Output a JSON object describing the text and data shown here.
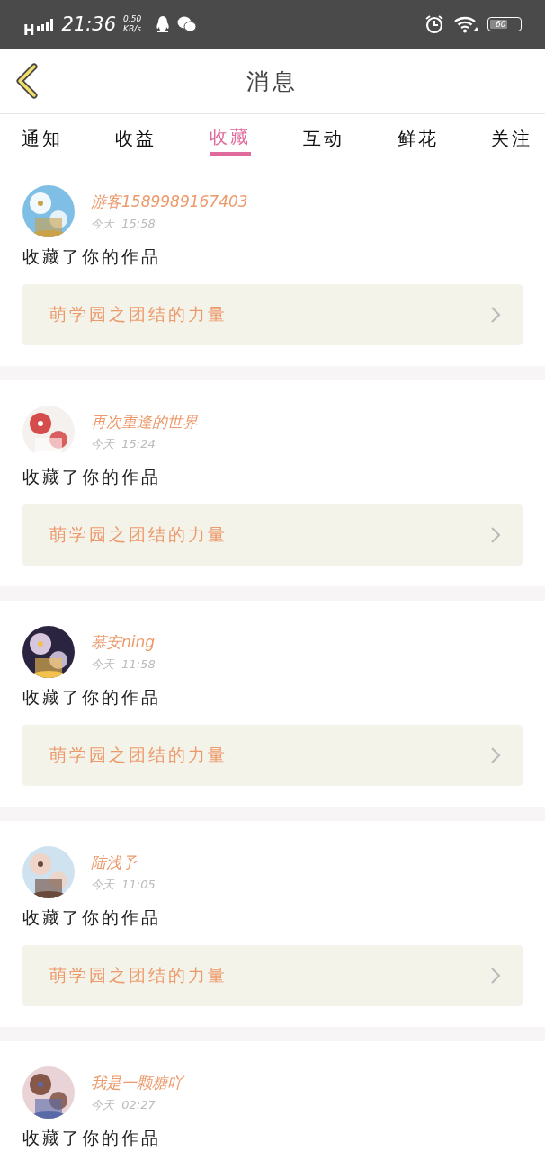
{
  "status_bar": {
    "network": "H",
    "time": "21:36",
    "speed": "0.50",
    "speed_unit": "KB/s",
    "battery": "60"
  },
  "header": {
    "title": "消息"
  },
  "tabs": [
    {
      "label": "通知",
      "selected": false
    },
    {
      "label": "收益",
      "selected": false
    },
    {
      "label": "收藏",
      "selected": true
    },
    {
      "label": "互动",
      "selected": false
    },
    {
      "label": "鲜花",
      "selected": false
    },
    {
      "label": "关注",
      "selected": false
    }
  ],
  "messages": [
    {
      "user": "游客1589989167403",
      "time": "今天  15:58",
      "text": "收藏了你的作品",
      "work": "萌学园之团结的力量"
    },
    {
      "user": "再次重逢的世界",
      "time": "今天  15:24",
      "text": "收藏了你的作品",
      "work": "萌学园之团结的力量"
    },
    {
      "user": "慕安ning",
      "time": "今天  11:58",
      "text": "收藏了你的作品",
      "work": "萌学园之团结的力量"
    },
    {
      "user": "陆浅予",
      "time": "今天  11:05",
      "text": "收藏了你的作品",
      "work": "萌学园之团结的力量"
    },
    {
      "user": "我是一颗糖吖",
      "time": "今天  02:27",
      "text": "收藏了你的作品"
    }
  ]
}
